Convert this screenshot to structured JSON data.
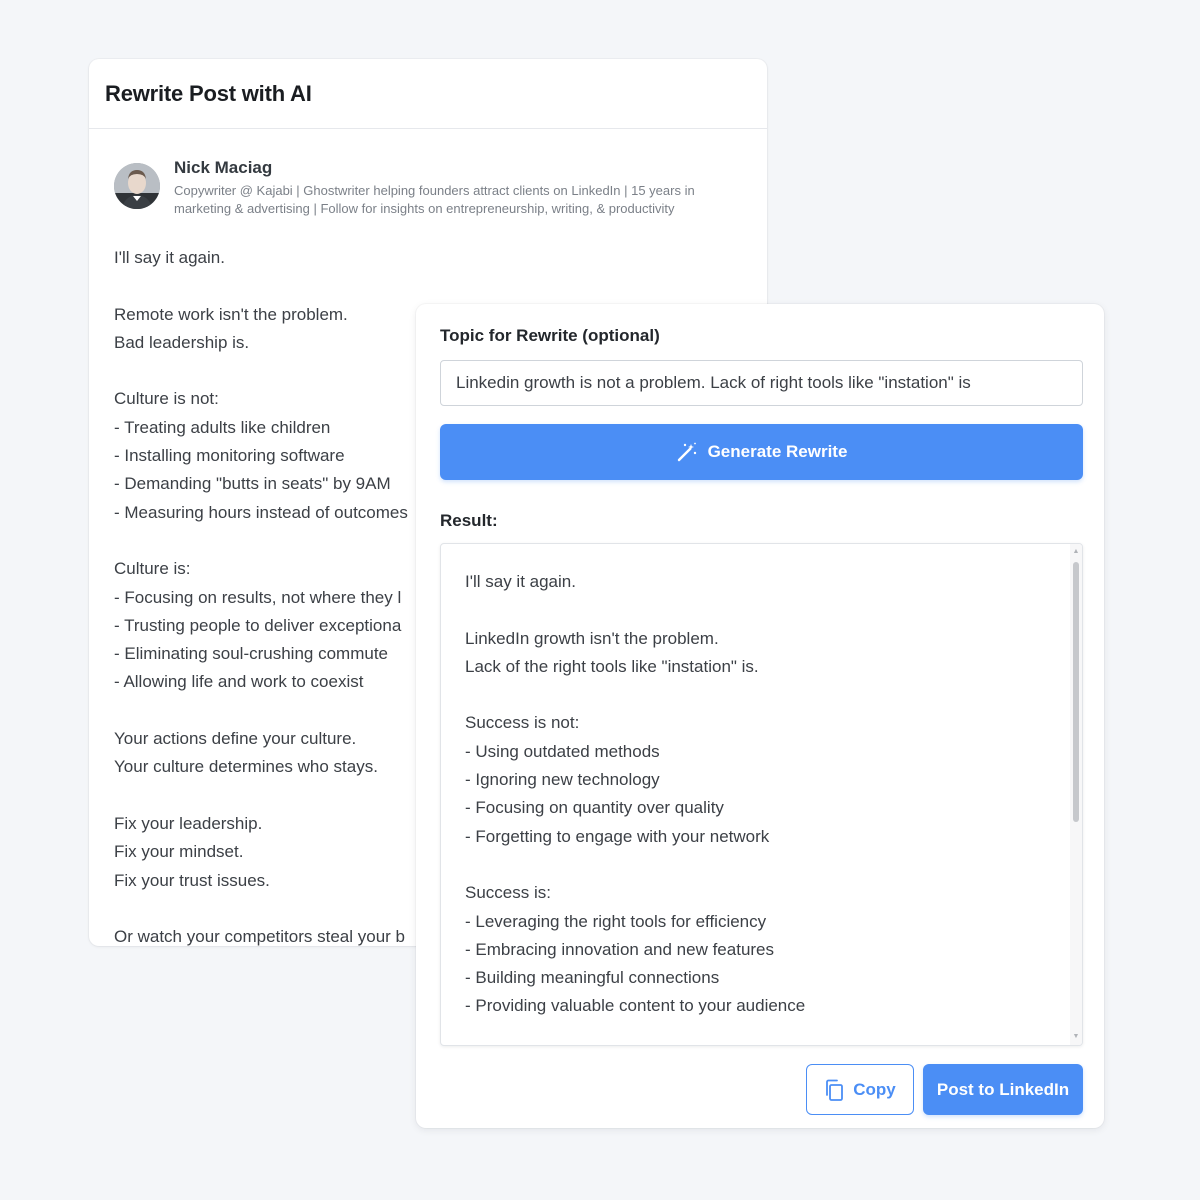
{
  "post_card": {
    "title": "Rewrite Post with AI",
    "author": {
      "name": "Nick Maciag",
      "headline": "Copywriter @ Kajabi | Ghostwriter helping founders attract clients on LinkedIn | 15 years in marketing & advertising | Follow for insights on entrepreneurship, writing, & productivity"
    },
    "body": "I'll say it again.\n\nRemote work isn't the problem.\nBad leadership is.\n\nCulture is not:\n- Treating adults like children\n- Installing monitoring software\n- Demanding \"butts in seats\" by 9AM\n- Measuring hours instead of outcomes\n\nCulture is:\n- Focusing on results, not where they l\n- Trusting people to deliver exceptiona\n- Eliminating soul-crushing commute\n- Allowing life and work to coexist\n\nYour actions define your culture.\nYour culture determines who stays.\n\nFix your leadership.\nFix your mindset.\nFix your trust issues.\n\nOr watch your competitors steal your b"
  },
  "rewrite_panel": {
    "topic_label": "Topic for Rewrite (optional)",
    "topic_value": "Linkedin growth is not a problem. Lack of right tools like \"instation\" is",
    "generate_label": "Generate Rewrite",
    "result_label": "Result:",
    "result_text": "I'll say it again.\n\nLinkedIn growth isn't the problem.\nLack of the right tools like \"instation\" is.\n\nSuccess is not:\n- Using outdated methods\n- Ignoring new technology\n- Focusing on quantity over quality\n- Forgetting to engage with your network\n\nSuccess is:\n- Leveraging the right tools for efficiency\n- Embracing innovation and new features\n- Building meaningful connections\n- Providing valuable content to your audience",
    "copy_label": "Copy",
    "post_label": "Post to LinkedIn"
  },
  "icons": {
    "generate": "magic-wand-icon",
    "copy": "copy-icon",
    "avatar": "user-avatar"
  },
  "colors": {
    "accent": "#4b8ef5",
    "background": "#f4f6f9"
  }
}
